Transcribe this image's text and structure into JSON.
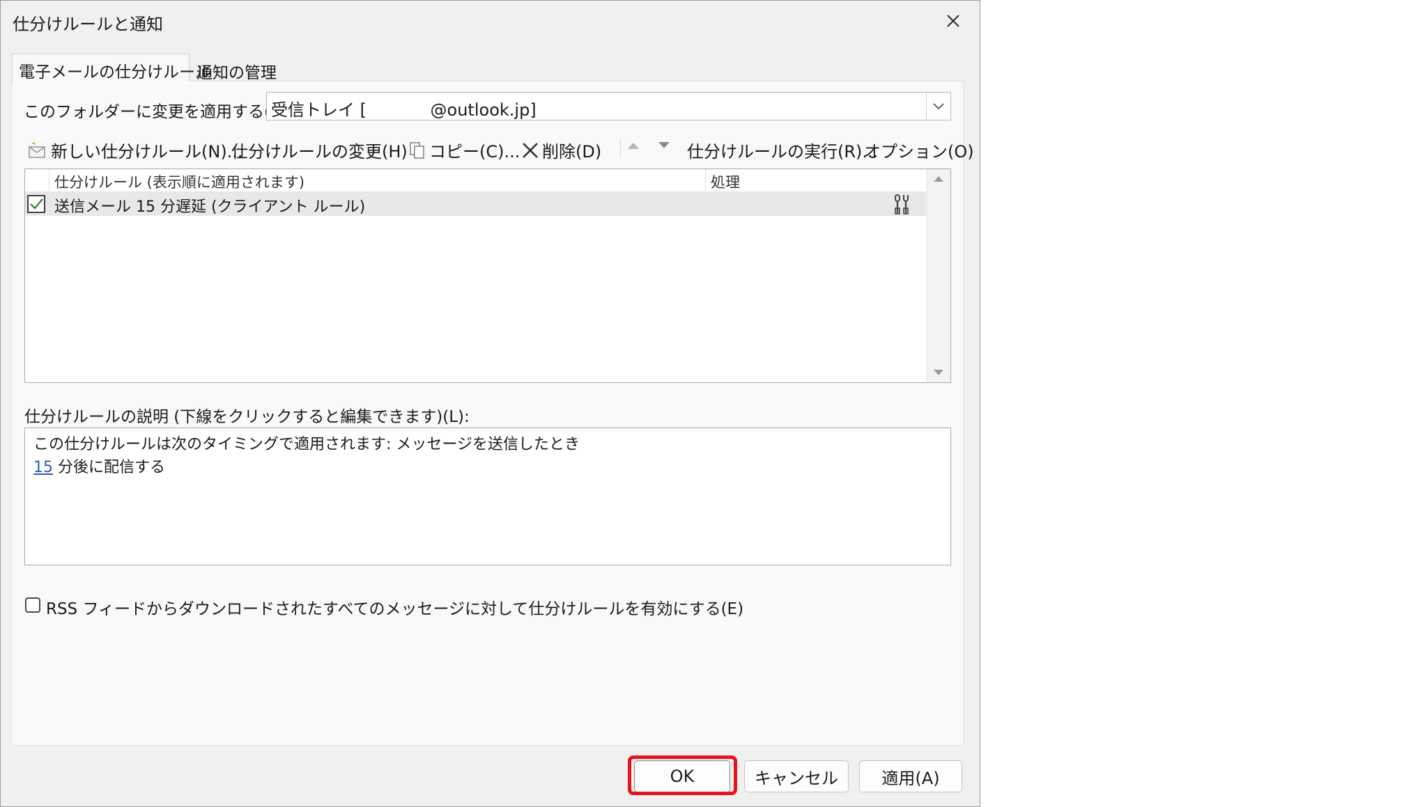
{
  "window": {
    "title": "仕分けルールと通知",
    "close_icon": "close-icon"
  },
  "tabs": [
    {
      "label": "電子メールの仕分けルール",
      "active": true
    },
    {
      "label": "通知の管理",
      "active": false
    }
  ],
  "folder": {
    "label": "このフォルダーに変更を適用する(F):",
    "value": "受信トレイ [            @outlook.jp]"
  },
  "toolbar": {
    "new_rule": "新しい仕分けルール(N)...",
    "change_rule": "仕分けルールの変更(H)",
    "copy": "コピー(C)...",
    "delete": "削除(D)",
    "run_rules": "仕分けルールの実行(R)...",
    "options": "オプション(O)"
  },
  "rules_list": {
    "col_rule": "仕分けルール (表示順に適用されます)",
    "col_action": "処理",
    "rows": [
      {
        "name": "送信メール 15 分遅延 (クライアント ルール)",
        "checked": true,
        "action_icon": "client-rule-icon"
      }
    ]
  },
  "description": {
    "label": "仕分けルールの説明 (下線をクリックすると編集できます)(L):",
    "line1": "この仕分けルールは次のタイミングで適用されます: メッセージを送信したとき",
    "line2_link": "15",
    "line2_rest": " 分後に配信する"
  },
  "rss": {
    "label": "RSS フィードからダウンロードされたすべてのメッセージに対して仕分けルールを有効にする(E)",
    "checked": false
  },
  "buttons": {
    "ok": "OK",
    "cancel": "キャンセル",
    "apply": "適用(A)"
  },
  "colors": {
    "highlight": "#e8141d",
    "link": "#2a5db0",
    "dialog_bg": "#f0f0f0",
    "check": "#2e7d32"
  }
}
